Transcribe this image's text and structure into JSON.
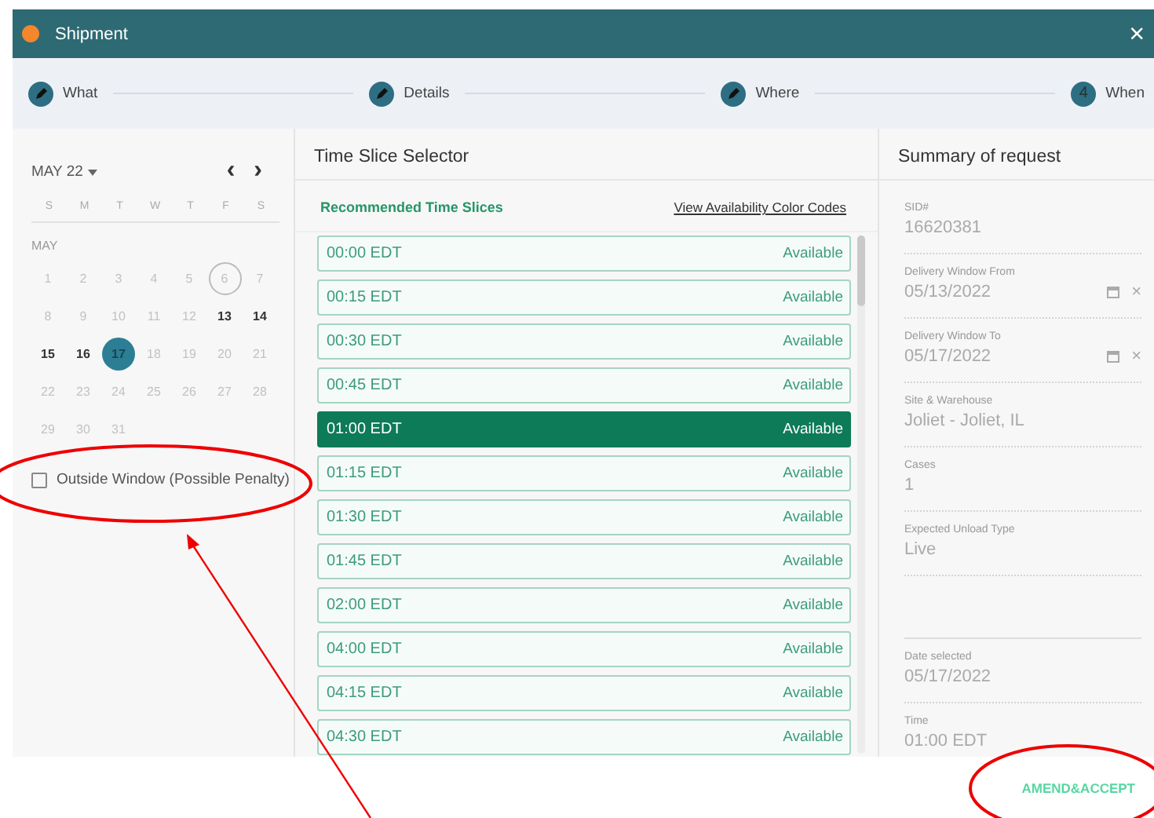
{
  "window": {
    "title": "Shipment",
    "close": "×"
  },
  "steps": [
    {
      "label": "What",
      "kind": "done"
    },
    {
      "label": "Details",
      "kind": "done"
    },
    {
      "label": "Where",
      "kind": "done"
    },
    {
      "label": "When",
      "kind": "current",
      "number": "4"
    }
  ],
  "calendar": {
    "month_label": "MAY 22",
    "prev": "‹",
    "next": "›",
    "weekdays": [
      "S",
      "M",
      "T",
      "W",
      "T",
      "F",
      "S"
    ],
    "month_name": "MAY",
    "days": [
      {
        "label": "1",
        "enabled": false,
        "today": false,
        "selected": false
      },
      {
        "label": "2",
        "enabled": false,
        "today": false,
        "selected": false
      },
      {
        "label": "3",
        "enabled": false,
        "today": false,
        "selected": false
      },
      {
        "label": "4",
        "enabled": false,
        "today": false,
        "selected": false
      },
      {
        "label": "5",
        "enabled": false,
        "today": false,
        "selected": false
      },
      {
        "label": "6",
        "enabled": false,
        "today": true,
        "selected": false
      },
      {
        "label": "7",
        "enabled": false,
        "today": false,
        "selected": false
      },
      {
        "label": "8",
        "enabled": false,
        "today": false,
        "selected": false
      },
      {
        "label": "9",
        "enabled": false,
        "today": false,
        "selected": false
      },
      {
        "label": "10",
        "enabled": false,
        "today": false,
        "selected": false
      },
      {
        "label": "11",
        "enabled": false,
        "today": false,
        "selected": false
      },
      {
        "label": "12",
        "enabled": false,
        "today": false,
        "selected": false
      },
      {
        "label": "13",
        "enabled": true,
        "today": false,
        "selected": false
      },
      {
        "label": "14",
        "enabled": true,
        "today": false,
        "selected": false
      },
      {
        "label": "15",
        "enabled": true,
        "today": false,
        "selected": false
      },
      {
        "label": "16",
        "enabled": true,
        "today": false,
        "selected": false
      },
      {
        "label": "17",
        "enabled": true,
        "today": false,
        "selected": true
      },
      {
        "label": "18",
        "enabled": false,
        "today": false,
        "selected": false
      },
      {
        "label": "19",
        "enabled": false,
        "today": false,
        "selected": false
      },
      {
        "label": "20",
        "enabled": false,
        "today": false,
        "selected": false
      },
      {
        "label": "21",
        "enabled": false,
        "today": false,
        "selected": false
      },
      {
        "label": "22",
        "enabled": false,
        "today": false,
        "selected": false
      },
      {
        "label": "23",
        "enabled": false,
        "today": false,
        "selected": false
      },
      {
        "label": "24",
        "enabled": false,
        "today": false,
        "selected": false
      },
      {
        "label": "25",
        "enabled": false,
        "today": false,
        "selected": false
      },
      {
        "label": "26",
        "enabled": false,
        "today": false,
        "selected": false
      },
      {
        "label": "27",
        "enabled": false,
        "today": false,
        "selected": false
      },
      {
        "label": "28",
        "enabled": false,
        "today": false,
        "selected": false
      },
      {
        "label": "29",
        "enabled": false,
        "today": false,
        "selected": false
      },
      {
        "label": "30",
        "enabled": false,
        "today": false,
        "selected": false
      },
      {
        "label": "31",
        "enabled": false,
        "today": false,
        "selected": false
      }
    ],
    "outside_window": {
      "label": "Outside Window (Possible Penalty)",
      "checked": false
    }
  },
  "time_slices": {
    "title": "Time Slice Selector",
    "subtitle": "Recommended Time Slices",
    "link": "View Availability Color Codes",
    "slots": [
      {
        "time": "00:00 EDT",
        "status": "Available",
        "selected": false
      },
      {
        "time": "00:15 EDT",
        "status": "Available",
        "selected": false
      },
      {
        "time": "00:30 EDT",
        "status": "Available",
        "selected": false
      },
      {
        "time": "00:45 EDT",
        "status": "Available",
        "selected": false
      },
      {
        "time": "01:00 EDT",
        "status": "Available",
        "selected": true
      },
      {
        "time": "01:15 EDT",
        "status": "Available",
        "selected": false
      },
      {
        "time": "01:30 EDT",
        "status": "Available",
        "selected": false
      },
      {
        "time": "01:45 EDT",
        "status": "Available",
        "selected": false
      },
      {
        "time": "02:00 EDT",
        "status": "Available",
        "selected": false
      },
      {
        "time": "04:00 EDT",
        "status": "Available",
        "selected": false
      },
      {
        "time": "04:15 EDT",
        "status": "Available",
        "selected": false
      },
      {
        "time": "04:30 EDT",
        "status": "Available",
        "selected": false
      }
    ]
  },
  "summary": {
    "title": "Summary of request",
    "fields": [
      {
        "label": "SID#",
        "value": "16620381",
        "kind": "text"
      },
      {
        "label": "Delivery Window From",
        "value": "05/13/2022",
        "kind": "date",
        "clear": "×"
      },
      {
        "label": "Delivery Window To",
        "value": "05/17/2022",
        "kind": "date",
        "clear": "×"
      },
      {
        "label": "Site & Warehouse",
        "value": "Joliet - Joliet, IL",
        "kind": "text"
      },
      {
        "label": "Cases",
        "value": "1",
        "kind": "text"
      },
      {
        "label": "Expected Unload Type",
        "value": "Live",
        "kind": "text"
      },
      {
        "kind": "spacer"
      },
      {
        "label": "Date selected",
        "value": "05/17/2022",
        "kind": "text"
      },
      {
        "label": "Time",
        "value": "01:00 EDT",
        "kind": "text"
      }
    ]
  },
  "footer": {
    "button": "AMEND&ACCEPT"
  }
}
